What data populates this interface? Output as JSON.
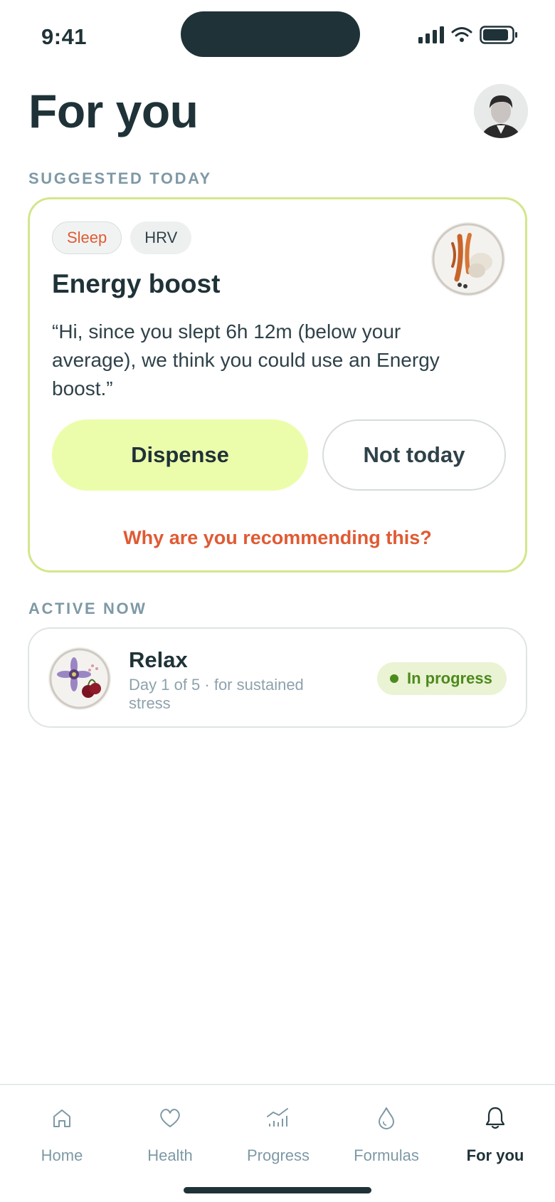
{
  "status_bar": {
    "time": "9:41"
  },
  "header": {
    "title": "For you"
  },
  "suggested": {
    "section_label": "SUGGESTED TODAY",
    "tags": [
      "Sleep",
      "HRV"
    ],
    "title": "Energy boost",
    "quote": "“Hi, since you slept 6h 12m (below your average), we think you could use an Energy boost.”",
    "dispense_label": "Dispense",
    "not_today_label": "Not today",
    "why_link": "Why are you recommending this?",
    "tag_accent_color": "#e05a33",
    "card_border_color": "#d2e78b",
    "primary_button_color": "#ebfdab"
  },
  "active": {
    "section_label": "ACTIVE NOW",
    "title": "Relax",
    "subtitle": "Day 1 of 5 · for sustained stress",
    "status_badge": "In progress",
    "status_color": "#4c8a1d"
  },
  "tab_bar": {
    "tabs": [
      {
        "label": "Home",
        "icon": "home-icon"
      },
      {
        "label": "Health",
        "icon": "heart-icon"
      },
      {
        "label": "Progress",
        "icon": "chart-icon"
      },
      {
        "label": "Formulas",
        "icon": "drop-icon"
      },
      {
        "label": "For you",
        "icon": "bell-icon",
        "active": true
      }
    ]
  }
}
